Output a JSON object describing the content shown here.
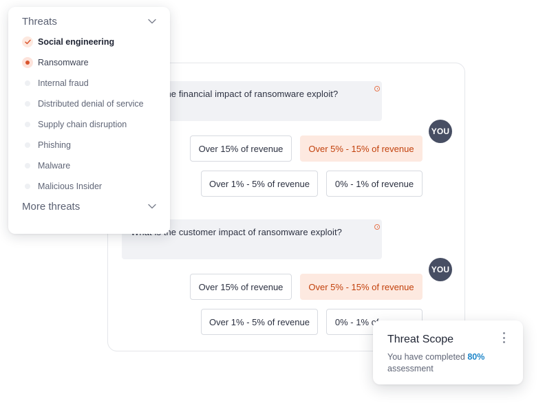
{
  "threats_panel": {
    "title": "Threats",
    "items": [
      {
        "label": "Social engineering",
        "state": "checked"
      },
      {
        "label": "Ransomware",
        "state": "current"
      },
      {
        "label": "Internal fraud",
        "state": "none"
      },
      {
        "label": "Distributed denial of service",
        "state": "none"
      },
      {
        "label": "Supply chain disruption",
        "state": "none"
      },
      {
        "label": "Phishing",
        "state": "none"
      },
      {
        "label": "Malware",
        "state": "none"
      },
      {
        "label": "Malicious Insider",
        "state": "none"
      }
    ],
    "more_label": "More threats",
    "chevron_icon": "chevron-down-icon"
  },
  "chat": {
    "questions": [
      {
        "text": "What is the financial impact of ransomware exploit?",
        "you_label": "YOU",
        "options": [
          "Over 15% of revenue",
          "Over 5% - 15% of revenue",
          "Over 1% - 5% of revenue",
          "0% - 1% of revenue"
        ],
        "selected": "Over 5% - 15% of revenue"
      },
      {
        "text": "What is the customer impact of ransomware exploit?",
        "you_label": "YOU",
        "options": [
          "Over 15% of revenue",
          "Over 5% - 15% of revenue",
          "Over 1% - 5% of revenue",
          "0% - 1% of revenue"
        ],
        "selected": "Over 5% - 15% of revenue"
      }
    ]
  },
  "scope_card": {
    "title": "Threat Scope",
    "text_before": "You have completed",
    "percent": "80%",
    "text_after": "assessment",
    "menu_icon": "more-vertical-icon"
  },
  "colors": {
    "accent": "#d9552e",
    "selected_bg": "#fde9e0",
    "selected_text": "#c2410c",
    "avatar_bg": "#474e63",
    "percent": "#1f86c9"
  }
}
